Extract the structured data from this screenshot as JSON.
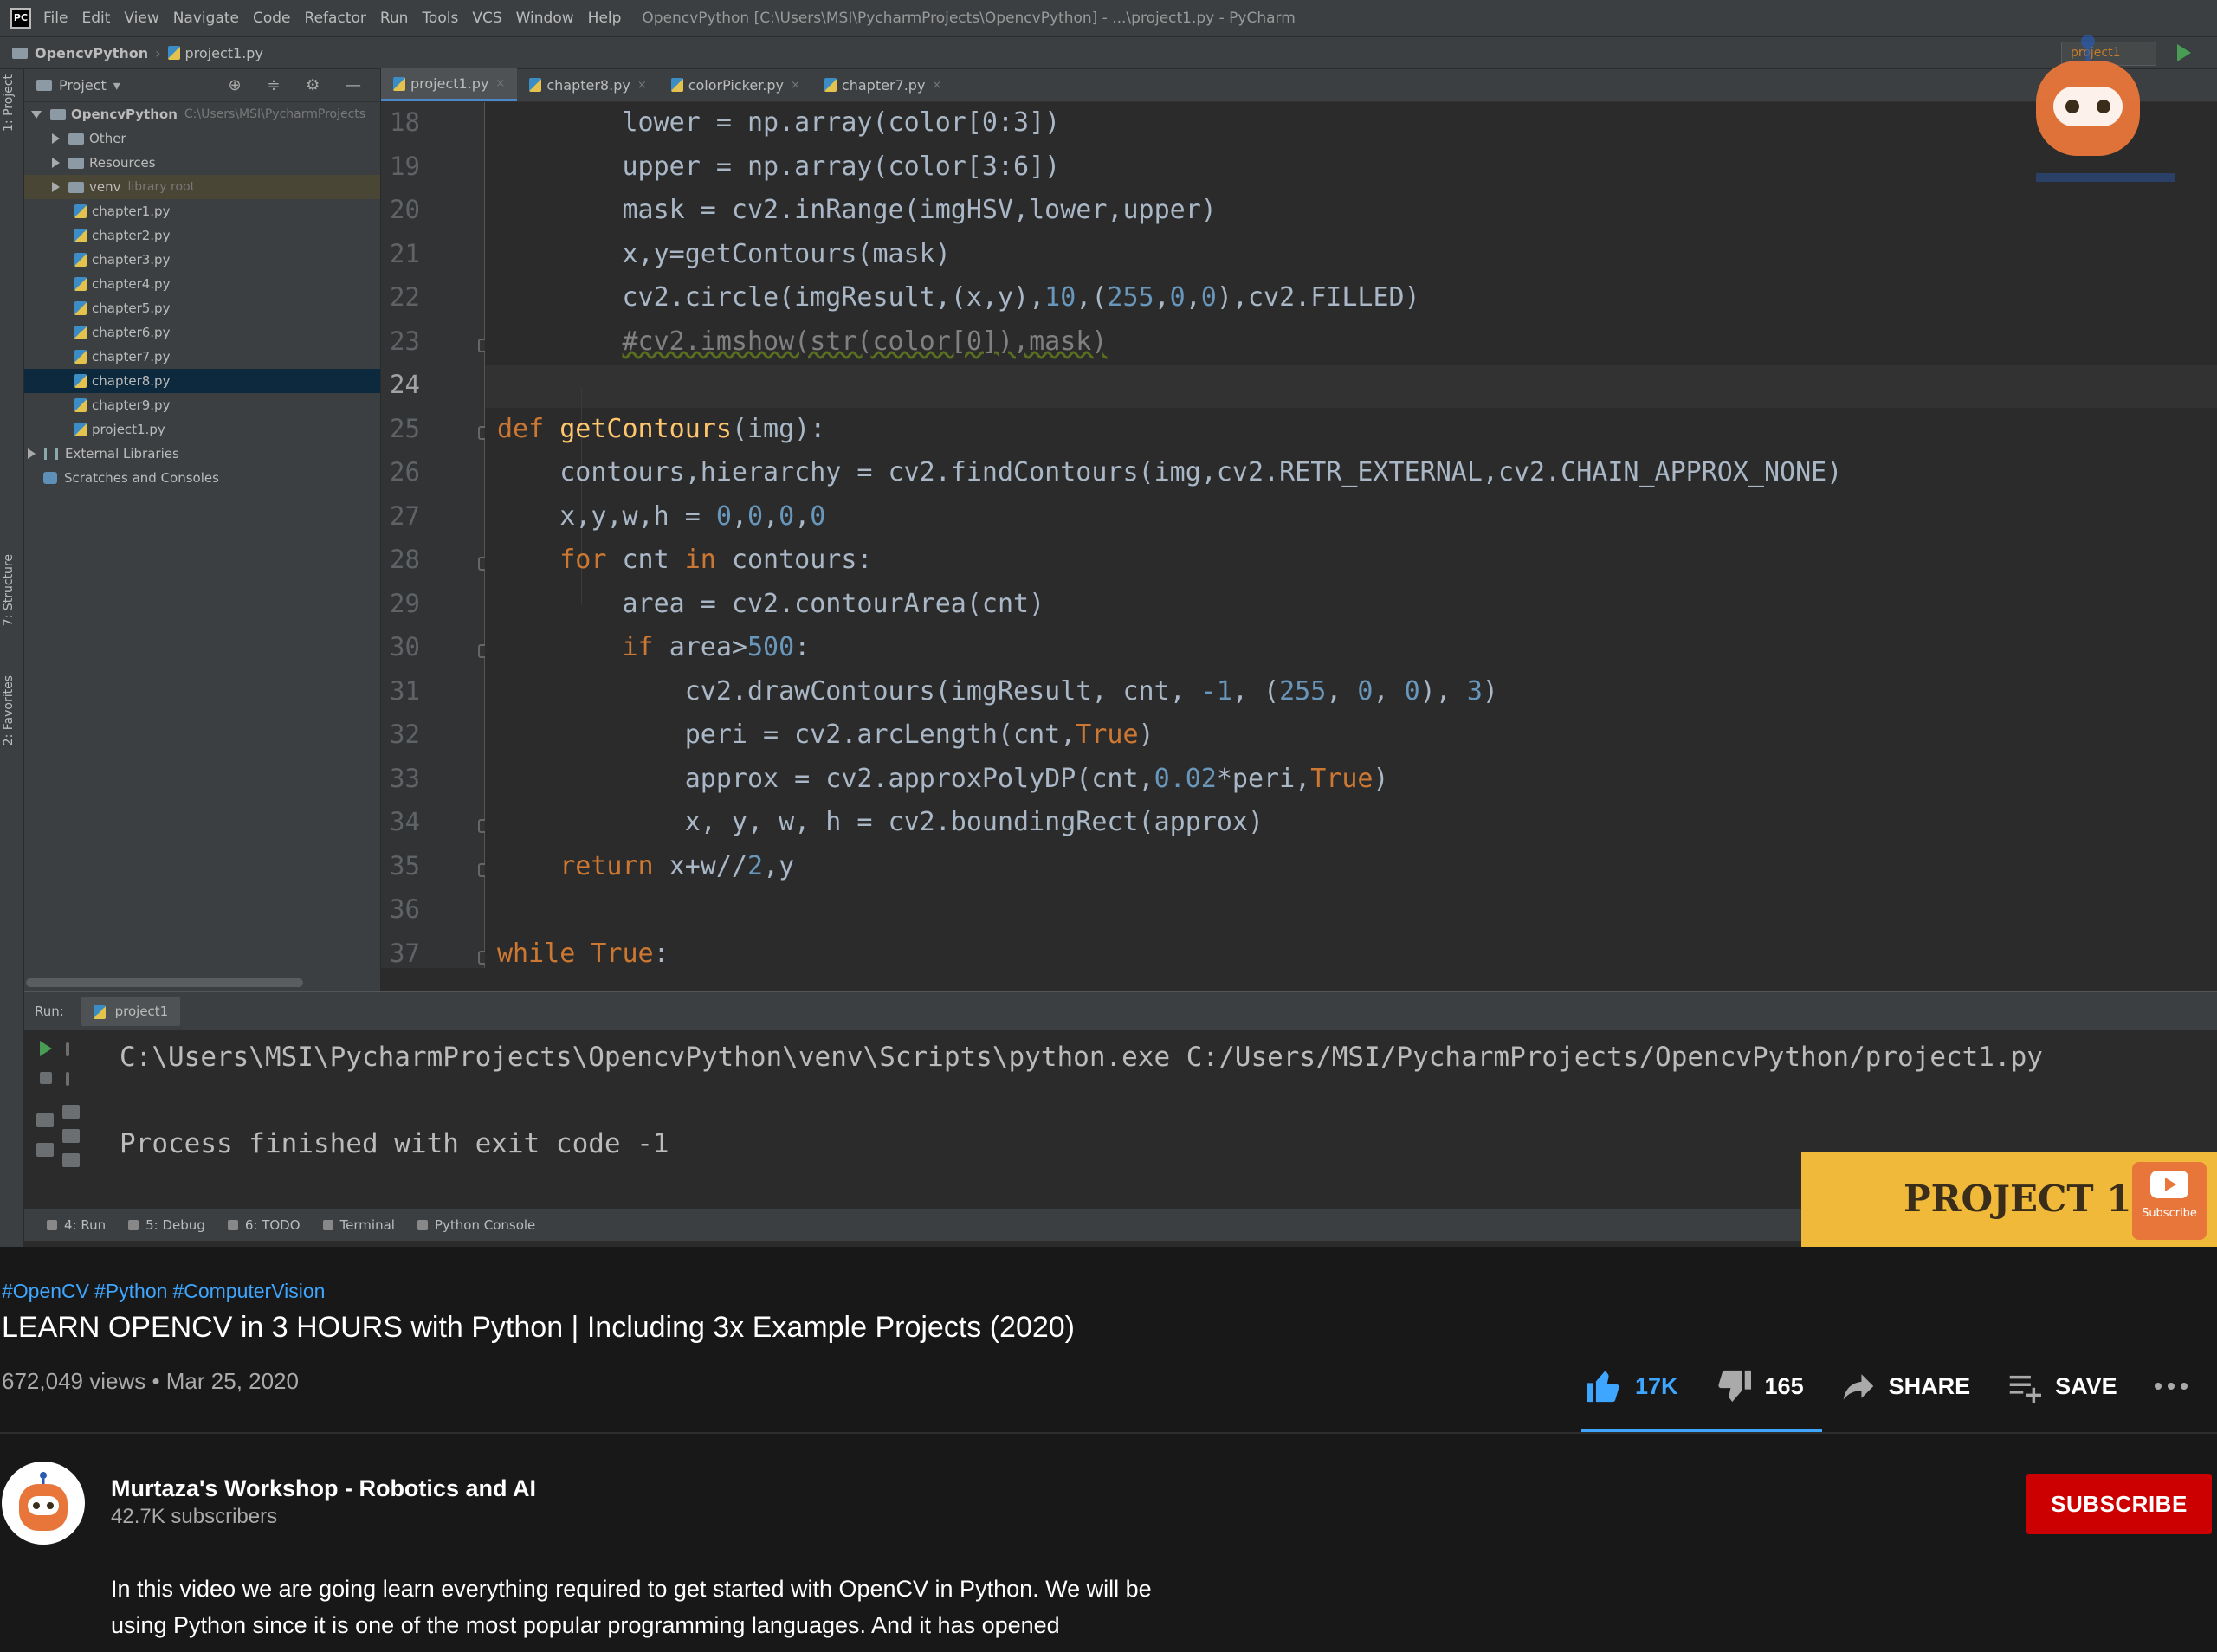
{
  "ide": {
    "menu": [
      "File",
      "Edit",
      "View",
      "Navigate",
      "Code",
      "Refactor",
      "Run",
      "Tools",
      "VCS",
      "Window",
      "Help"
    ],
    "window_title": "OpencvPython [C:\\Users\\MSI\\PycharmProjects\\OpencvPython] - ...\\project1.py - PyCharm",
    "breadcrumb": {
      "project": "OpencvPython",
      "file": "project1.py"
    },
    "run_config": "project1",
    "side_tabs": {
      "project": "1: Project",
      "structure": "7: Structure",
      "favorites": "2: Favorites"
    },
    "project_panel": {
      "header": "Project",
      "root": {
        "name": "OpencvPython",
        "path": "C:\\Users\\MSI\\PycharmProjects"
      },
      "folders": [
        {
          "name": "Other",
          "note": ""
        },
        {
          "name": "Resources",
          "note": ""
        },
        {
          "name": "venv",
          "note": "library root"
        }
      ],
      "files": [
        "chapter1.py",
        "chapter2.py",
        "chapter3.py",
        "chapter4.py",
        "chapter5.py",
        "chapter6.py",
        "chapter7.py",
        "chapter8.py",
        "chapter9.py",
        "project1.py"
      ],
      "selected_file": "chapter8.py",
      "external_libraries": "External Libraries",
      "scratches": "Scratches and Consoles"
    },
    "tabs": [
      "project1.py",
      "chapter8.py",
      "colorPicker.py",
      "chapter7.py"
    ],
    "active_tab": "project1.py",
    "code": {
      "current_line": "24",
      "lines": [
        {
          "no": "18",
          "segments": [
            {
              "t": "        lower = np.array(color[0:3])",
              "c": ""
            }
          ]
        },
        {
          "no": "19",
          "segments": [
            {
              "t": "        upper = np.array(color[3:6])",
              "c": ""
            }
          ]
        },
        {
          "no": "20",
          "segments": [
            {
              "t": "        mask = cv2.inRange(imgHSV,lower,upper)",
              "c": ""
            }
          ]
        },
        {
          "no": "21",
          "segments": [
            {
              "t": "        x,y=getContours(mask)",
              "c": ""
            }
          ]
        },
        {
          "no": "22",
          "segments": [
            {
              "t": "        cv2.circle(imgResult,(x,y),",
              "c": ""
            },
            {
              "t": "10",
              "c": "num"
            },
            {
              "t": ",(",
              "c": ""
            },
            {
              "t": "255",
              "c": "num"
            },
            {
              "t": ",",
              "c": ""
            },
            {
              "t": "0",
              "c": "num"
            },
            {
              "t": ",",
              "c": ""
            },
            {
              "t": "0",
              "c": "num"
            },
            {
              "t": "),cv2.FILLED)",
              "c": ""
            }
          ]
        },
        {
          "no": "23",
          "segments": [
            {
              "t": "        ",
              "c": ""
            },
            {
              "t": "#cv2.imshow(str(color[0]),mask)",
              "c": "cm"
            }
          ]
        },
        {
          "no": "24",
          "segments": [
            {
              "t": "",
              "c": ""
            }
          ]
        },
        {
          "no": "25",
          "segments": [
            {
              "t": "def ",
              "c": "kw"
            },
            {
              "t": "getContours",
              "c": "fn"
            },
            {
              "t": "(img):",
              "c": ""
            }
          ]
        },
        {
          "no": "26",
          "segments": [
            {
              "t": "    contours,hierarchy = cv2.findContours(img,cv2.RETR_EXTERNAL,cv2.CHAIN_APPROX_NONE)",
              "c": ""
            }
          ]
        },
        {
          "no": "27",
          "segments": [
            {
              "t": "    x,y,w,h = ",
              "c": ""
            },
            {
              "t": "0",
              "c": "num"
            },
            {
              "t": ",",
              "c": ""
            },
            {
              "t": "0",
              "c": "num"
            },
            {
              "t": ",",
              "c": ""
            },
            {
              "t": "0",
              "c": "num"
            },
            {
              "t": ",",
              "c": ""
            },
            {
              "t": "0",
              "c": "num"
            }
          ]
        },
        {
          "no": "28",
          "segments": [
            {
              "t": "    ",
              "c": ""
            },
            {
              "t": "for ",
              "c": "kw"
            },
            {
              "t": "cnt ",
              "c": ""
            },
            {
              "t": "in ",
              "c": "kw"
            },
            {
              "t": "contours:",
              "c": ""
            }
          ]
        },
        {
          "no": "29",
          "segments": [
            {
              "t": "        area = cv2.contourArea(cnt)",
              "c": ""
            }
          ]
        },
        {
          "no": "30",
          "segments": [
            {
              "t": "        ",
              "c": ""
            },
            {
              "t": "if ",
              "c": "kw"
            },
            {
              "t": "area>",
              "c": ""
            },
            {
              "t": "500",
              "c": "num"
            },
            {
              "t": ":",
              "c": ""
            }
          ]
        },
        {
          "no": "31",
          "segments": [
            {
              "t": "            cv2.drawContours(imgResult, cnt, ",
              "c": ""
            },
            {
              "t": "-1",
              "c": "num"
            },
            {
              "t": ", (",
              "c": ""
            },
            {
              "t": "255",
              "c": "num"
            },
            {
              "t": ", ",
              "c": ""
            },
            {
              "t": "0",
              "c": "num"
            },
            {
              "t": ", ",
              "c": ""
            },
            {
              "t": "0",
              "c": "num"
            },
            {
              "t": "), ",
              "c": ""
            },
            {
              "t": "3",
              "c": "num"
            },
            {
              "t": ")",
              "c": ""
            }
          ]
        },
        {
          "no": "32",
          "segments": [
            {
              "t": "            peri = cv2.arcLength(cnt,",
              "c": ""
            },
            {
              "t": "True",
              "c": "kw"
            },
            {
              "t": ")",
              "c": ""
            }
          ]
        },
        {
          "no": "33",
          "segments": [
            {
              "t": "            approx = cv2.approxPolyDP(cnt,",
              "c": ""
            },
            {
              "t": "0.02",
              "c": "num"
            },
            {
              "t": "*peri,",
              "c": ""
            },
            {
              "t": "True",
              "c": "kw"
            },
            {
              "t": ")",
              "c": ""
            }
          ]
        },
        {
          "no": "34",
          "segments": [
            {
              "t": "            x, y, w, h = cv2.boundingRect(approx)",
              "c": ""
            }
          ]
        },
        {
          "no": "35",
          "segments": [
            {
              "t": "    ",
              "c": ""
            },
            {
              "t": "return ",
              "c": "kw"
            },
            {
              "t": "x+w//",
              "c": ""
            },
            {
              "t": "2",
              "c": "num"
            },
            {
              "t": ",y",
              "c": ""
            }
          ]
        },
        {
          "no": "36",
          "segments": [
            {
              "t": "",
              "c": ""
            }
          ]
        },
        {
          "no": "37",
          "segments": [
            {
              "t": "while ",
              "c": "kw"
            },
            {
              "t": "True",
              "c": "kw"
            },
            {
              "t": ":",
              "c": ""
            }
          ]
        }
      ]
    },
    "run_panel": {
      "label": "Run:",
      "tab": "project1",
      "output": [
        "C:\\Users\\MSI\\PycharmProjects\\OpencvPython\\venv\\Scripts\\python.exe C:/Users/MSI/PycharmProjects/OpencvPython/project1.py",
        "",
        "Process finished with exit code -1"
      ]
    },
    "bottom_tools": [
      "4: Run",
      "5: Debug",
      "6: TODO",
      "Terminal",
      "Python Console"
    ]
  },
  "overlay": {
    "banner_title": "PROJECT 1",
    "subscribe_badge": "Subscribe",
    "banner_color": "#f1b93a"
  },
  "video": {
    "hashtags": [
      "#OpenCV",
      "#Python",
      "#ComputerVision"
    ],
    "title": "LEARN OPENCV in 3 HOURS with Python | Including 3x Example Projects (2020)",
    "meta": "672,049 views • Mar 25, 2020",
    "like_count": "17K",
    "dislike_count": "165",
    "share_label": "SHARE",
    "save_label": "SAVE",
    "accent_color": "#3ea6ff"
  },
  "channel": {
    "name": "Murtaza's Workshop - Robotics and AI",
    "subscribers": "42.7K subscribers",
    "subscribe_label": "SUBSCRIBE"
  },
  "description": "In this video we are going learn everything required to get started with OpenCV in Python. We will be using Python since it is one of the most popular programming languages. And it  has opened"
}
